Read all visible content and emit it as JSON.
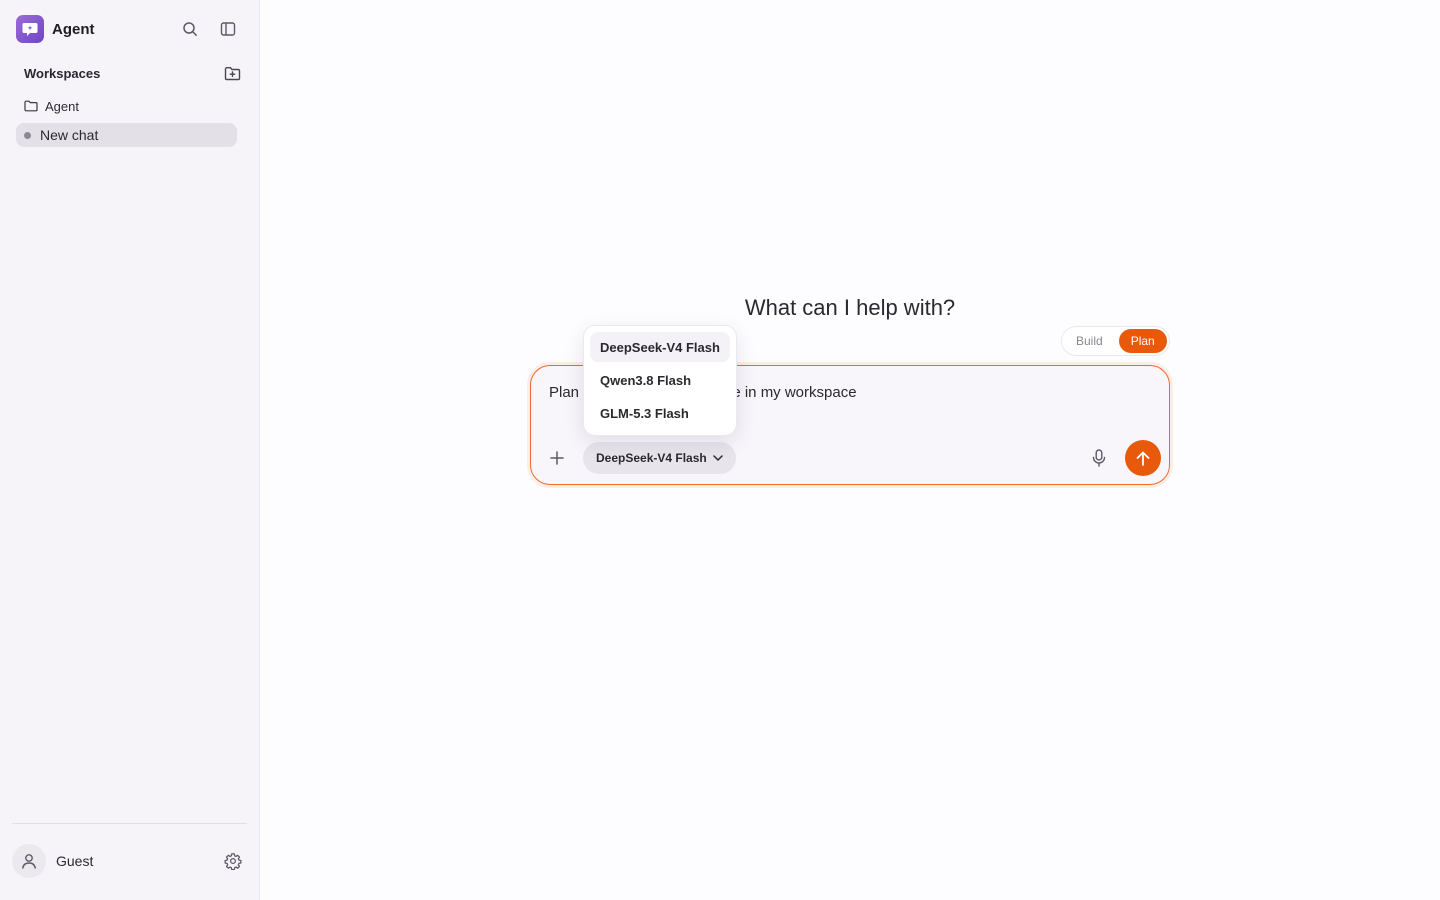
{
  "app": {
    "name": "Agent"
  },
  "sidebar": {
    "section_title": "Workspaces",
    "workspace": {
      "label": "Agent"
    },
    "chat": {
      "label": "New chat"
    },
    "user": {
      "name": "Guest"
    }
  },
  "main": {
    "headline": "What can I help with?",
    "modes": [
      {
        "label": "Build",
        "active": false
      },
      {
        "label": "Plan",
        "active": true
      }
    ],
    "composer": {
      "text_prefix": "Plan",
      "text_suffix": "ure in my workspace",
      "model": "DeepSeek-V4 Flash"
    },
    "model_menu": [
      {
        "label": "DeepSeek-V4 Flash",
        "selected": true
      },
      {
        "label": "Qwen3.8 Flash",
        "selected": false
      },
      {
        "label": "GLM-5.3 Flash",
        "selected": false
      }
    ]
  },
  "colors": {
    "accent": "#e8590c",
    "brand": "#7c52c9",
    "sidebar_bg": "#f6f3f9"
  },
  "icons": {
    "search": "search-icon",
    "sidebar_toggle": "sidebar-toggle-icon",
    "new_folder": "folder-plus-icon",
    "folder": "folder-icon",
    "user": "user-icon",
    "settings": "gear-icon",
    "plus": "plus-icon",
    "chevron": "chevron-down-icon",
    "mic": "microphone-icon",
    "send": "arrow-up-icon"
  }
}
